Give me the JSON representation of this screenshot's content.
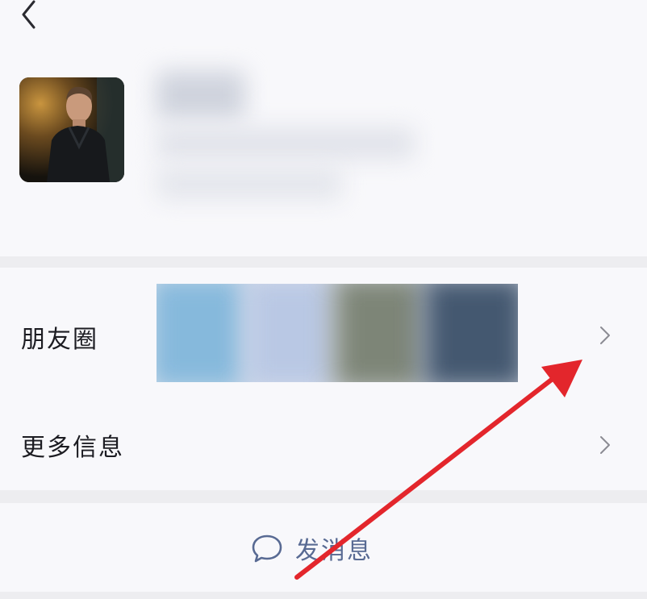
{
  "header": {
    "back_icon": "chevron-left-icon"
  },
  "profile": {
    "avatar_icon": "avatar"
  },
  "list": {
    "moments_label": "朋友圈",
    "more_info_label": "更多信息",
    "chevron_icon": "chevron-right-icon"
  },
  "actions": {
    "send_message_label": "发消息",
    "send_message_icon": "chat-bubble-icon"
  },
  "colors": {
    "background": "#ededf0",
    "card": "#f8f8fb",
    "text_primary": "#1c1c22",
    "link_blue": "#586a93",
    "annotation_red": "#e3262c"
  }
}
